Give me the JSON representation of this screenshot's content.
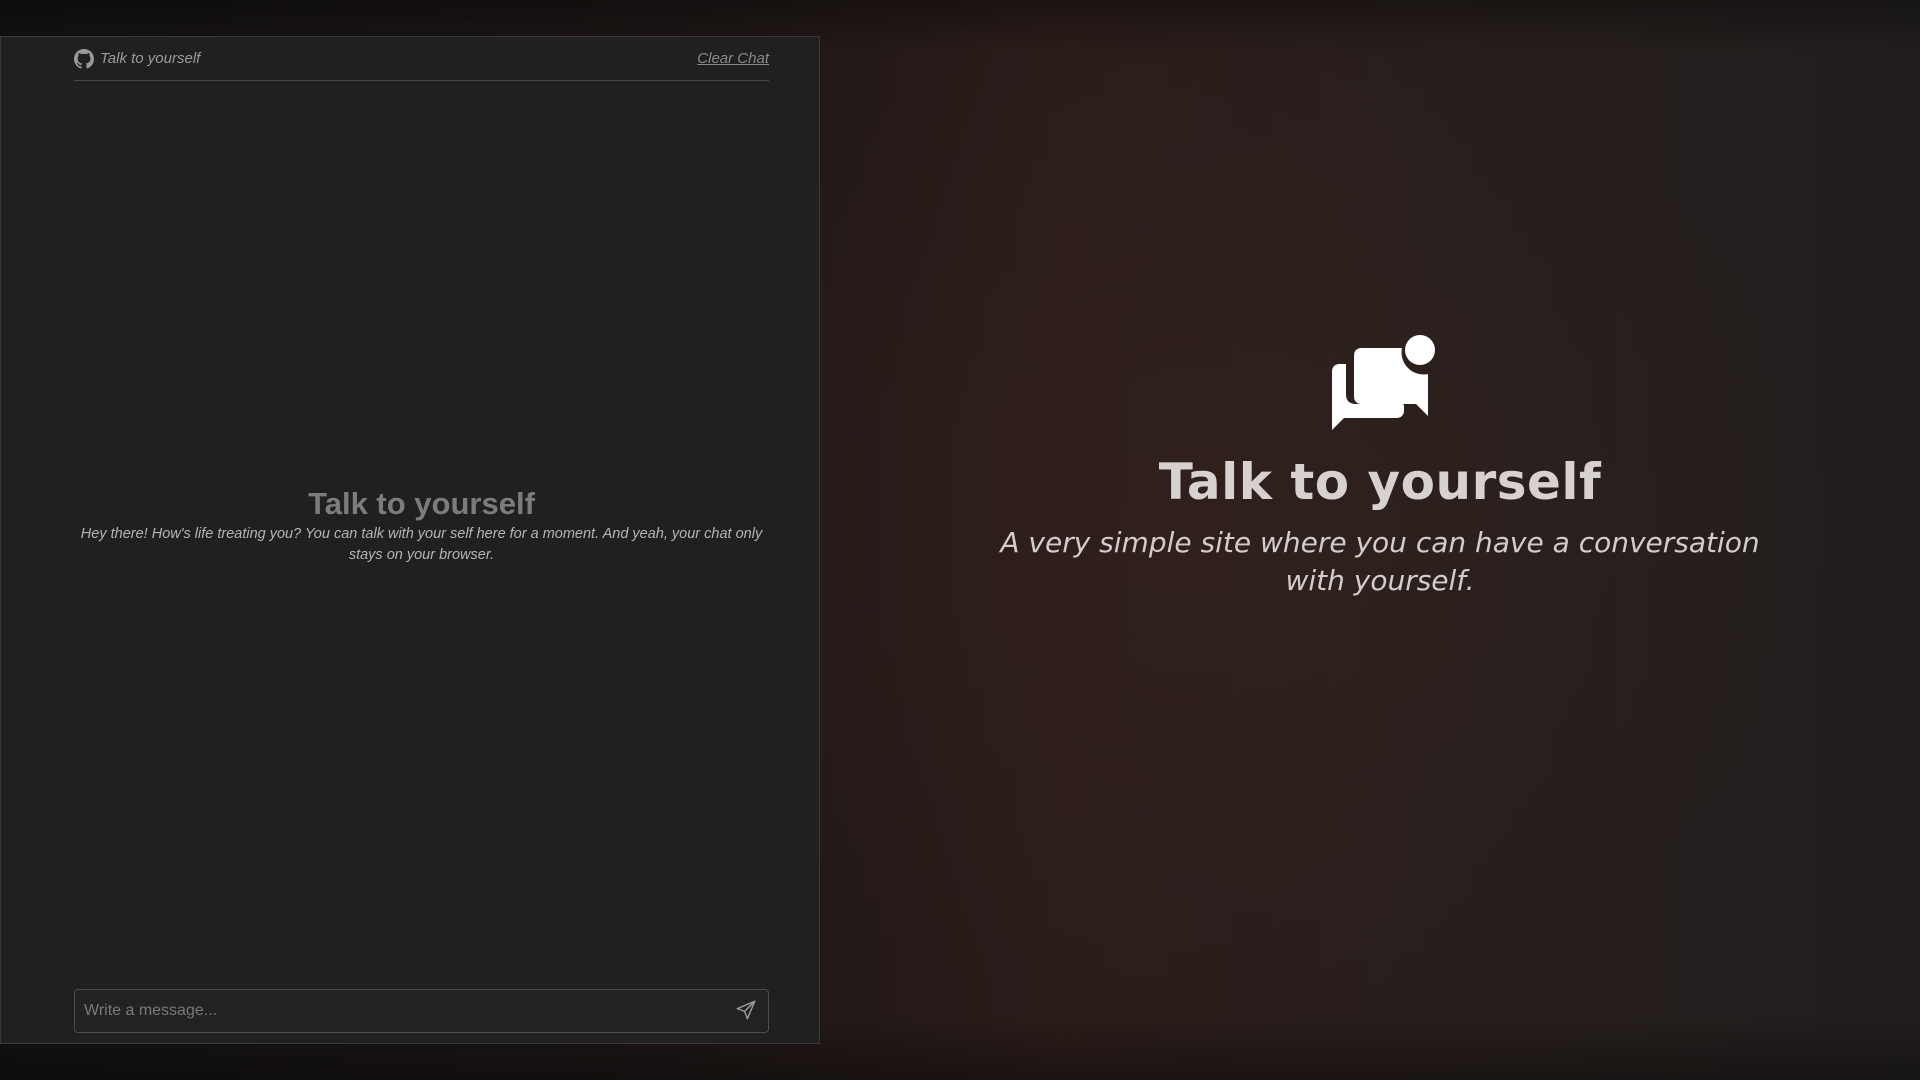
{
  "chat": {
    "brand_label": "Talk to yourself",
    "clear_label": "Clear Chat",
    "empty_title": "Talk to yourself",
    "empty_text": "Hey there! How's life treating you? You can talk with your self here for a moment. And yeah, your chat only stays on your browser.",
    "input_placeholder": "Write a message...",
    "input_value": ""
  },
  "hero": {
    "title": "Talk to yourself",
    "subtitle": "A very simple site where you can have a conversation with yourself."
  },
  "icons": {
    "brand": "github-icon",
    "send": "send-icon",
    "logo": "chat-bubbles-logo-icon"
  },
  "colors": {
    "panel_bg": "#202020",
    "hero_text": "#d7d2d0",
    "muted_text": "#9a9a9a"
  }
}
